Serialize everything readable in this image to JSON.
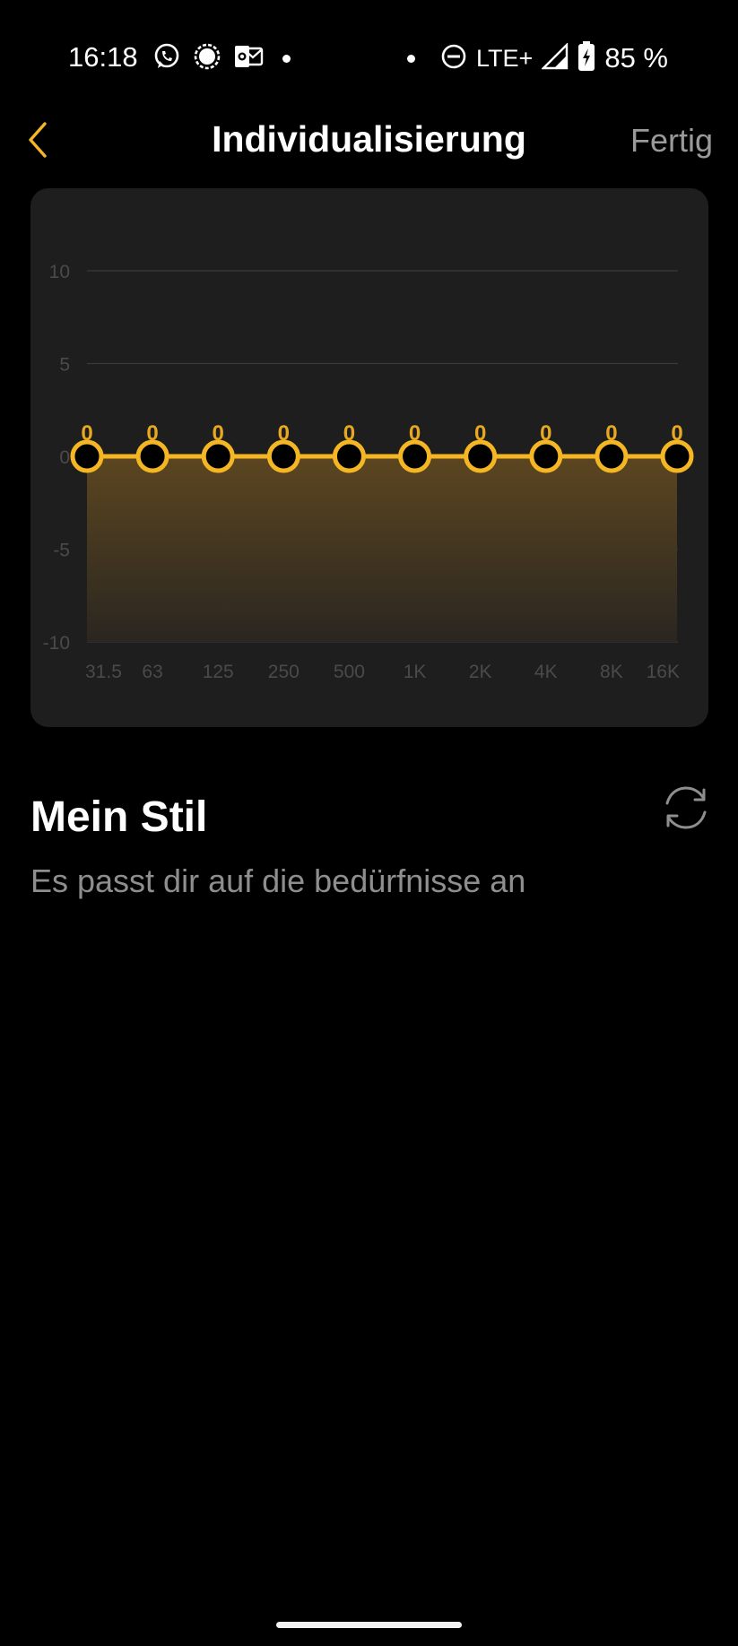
{
  "status_bar": {
    "time": "16:18",
    "network": "LTE+",
    "battery": "85 %",
    "icons": [
      "whatsapp-icon",
      "signal-messenger-icon",
      "outlook-icon",
      "dot-icon",
      "dot-icon",
      "do-not-disturb-icon",
      "cell-signal-icon",
      "battery-charging-icon"
    ]
  },
  "header": {
    "title": "Individualisierung",
    "done_label": "Fertig",
    "back_icon": "chevron-left-icon"
  },
  "chart_data": {
    "type": "line",
    "categories": [
      "31.5",
      "63",
      "125",
      "250",
      "500",
      "1K",
      "2K",
      "4K",
      "8K",
      "16K"
    ],
    "values": [
      0,
      0,
      0,
      0,
      0,
      0,
      0,
      0,
      0,
      0
    ],
    "point_labels": [
      "0",
      "0",
      "0",
      "0",
      "0",
      "0",
      "0",
      "0",
      "0",
      "0"
    ],
    "y_ticks": [
      "10",
      "5",
      "0",
      "-5",
      "-10"
    ],
    "ylim": [
      -10,
      10
    ],
    "grid": true,
    "colors": {
      "line": "#f5b623",
      "fill_top": "#5c4620",
      "fill_bottom": "#2a2620",
      "gridline": "#3a3a3a",
      "tick_label": "#4a4a4a",
      "point_label": "#e8a921"
    }
  },
  "style": {
    "title": "Mein Stil",
    "description": "Es passt dir auf die bedürfnisse an",
    "refresh_icon": "refresh-icon"
  },
  "colors": {
    "accent": "#f5b623",
    "background": "#000000",
    "card": "#1e1e1e"
  }
}
